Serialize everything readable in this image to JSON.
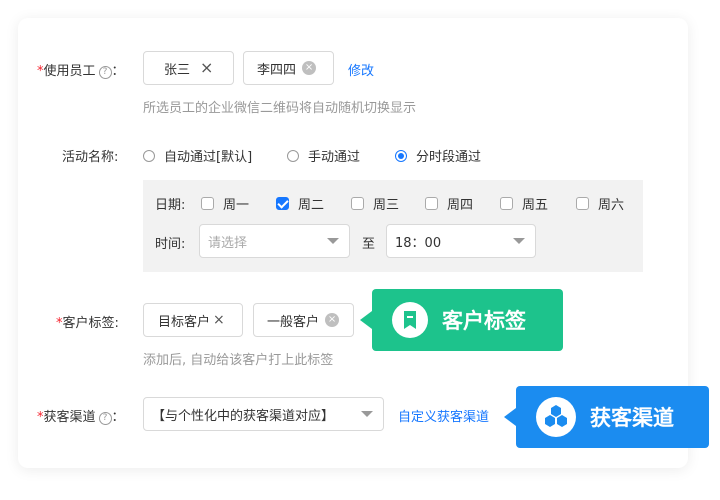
{
  "staff": {
    "label": "使用员工",
    "required": "*",
    "help_icon": "?",
    "tags": [
      {
        "name": "张三",
        "remove": "×"
      },
      {
        "name": "李四四",
        "remove": "×"
      }
    ],
    "edit_link": "修改",
    "hint": "所选员工的企业微信二维码将自动随机切换显示"
  },
  "activity": {
    "label": "活动名称:",
    "options": [
      "自动通过[默认]",
      "手动通过",
      "分时段通过"
    ],
    "selected": "分时段通过"
  },
  "schedule": {
    "date_label": "日期:",
    "days": [
      {
        "label": "周一",
        "checked": false
      },
      {
        "label": "周二",
        "checked": true
      },
      {
        "label": "周三",
        "checked": false
      },
      {
        "label": "周四",
        "checked": false
      },
      {
        "label": "周五",
        "checked": false
      },
      {
        "label": "周六",
        "checked": false
      }
    ],
    "time_label": "时间:",
    "start_placeholder": "请选择",
    "to_label": "至",
    "end_value": "18：00"
  },
  "customer_tags": {
    "label": "客户标签:",
    "required": "*",
    "tags": [
      {
        "name": "目标客户",
        "remove": "×"
      },
      {
        "name": "一般客户",
        "remove": "×"
      }
    ],
    "hint": "添加后, 自动给该客户打上此标签",
    "callout": "客户标签",
    "callout_color": "#1dc38c",
    "callout_icon": "bookmark-icon"
  },
  "channel": {
    "label": "获客渠道",
    "required": "*",
    "help_icon": "?",
    "select_value": "【与个性化中的获客渠道对应】",
    "custom_link": "自定义获客渠道",
    "callout": "获客渠道",
    "callout_color": "#1b8cf0",
    "callout_icon": "cubes-icon"
  },
  "colors": {
    "accent": "#1677ff",
    "required": "#f5222d"
  }
}
